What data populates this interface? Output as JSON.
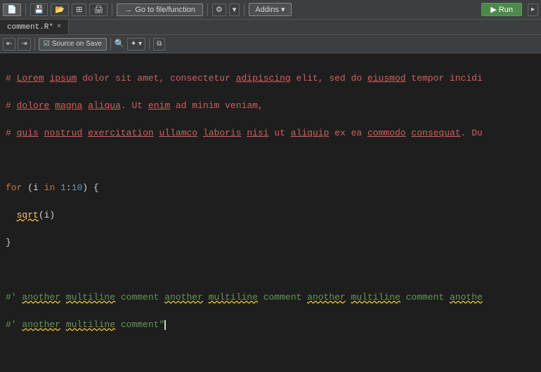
{
  "toolbar": {
    "go_to_label": "Go to file/function",
    "addins_label": "Addins ▾",
    "run_label": "▶ Run",
    "more_label": "▸"
  },
  "tab": {
    "filename": "comment.R*",
    "close": "×"
  },
  "sec_toolbar": {
    "save_label": "Source on Save",
    "search_placeholder": ""
  },
  "editor": {
    "line1": "# Lorem ipsum dolor sit amet, consectetur adipiscing elit, sed do eiusmod tempor incidi",
    "line2": "# dolore magna aliqua. Ut enim ad minim veniam,",
    "line3": "# quis nostrud exercitation ullamco laboris nisi ut aliquip ex ea commodo consequat. Du",
    "line4_empty": "",
    "line5": "for (i in 1:10) {",
    "line6": "  sqrt(i)",
    "line7": "}",
    "line8_empty": "",
    "line9": "#' another multiline comment another multiline comment another multiline comment anothe",
    "line10": "#' another multiline comment\""
  }
}
